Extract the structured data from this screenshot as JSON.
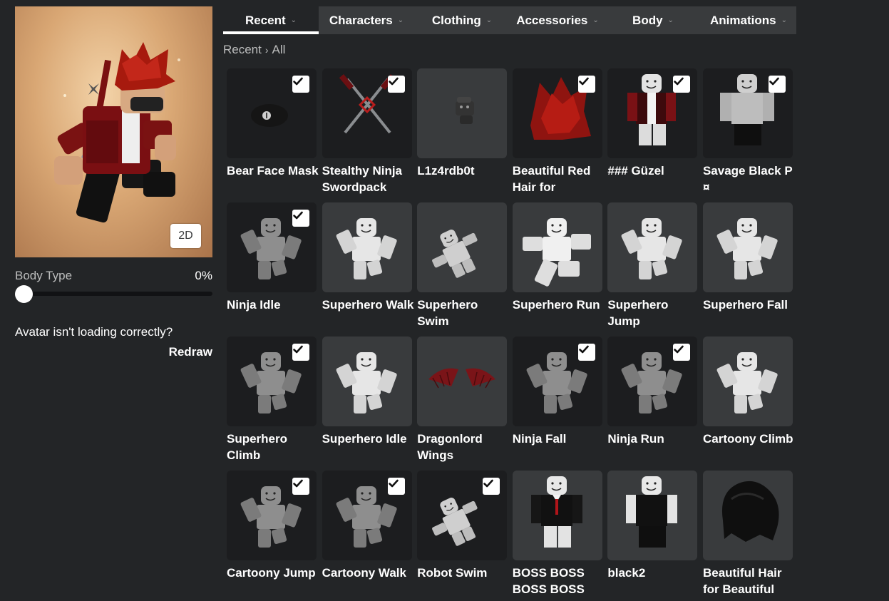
{
  "preview": {
    "toggle_label": "2D"
  },
  "body_type": {
    "label": "Body Type",
    "value": "0%",
    "level_percent": 0
  },
  "loading": {
    "message": "Avatar isn't loading correctly?",
    "redraw_label": "Redraw"
  },
  "tabs": [
    {
      "label": "Recent",
      "active": true
    },
    {
      "label": "Characters",
      "active": false
    },
    {
      "label": "Clothing",
      "active": false
    },
    {
      "label": "Accessories",
      "active": false
    },
    {
      "label": "Body",
      "active": false
    },
    {
      "label": "Animations",
      "active": false
    }
  ],
  "breadcrumb": {
    "parent": "Recent",
    "current": "All"
  },
  "items": [
    {
      "name": "Bear Face Mask",
      "selected": true,
      "bg": "dark",
      "thumb": "mask"
    },
    {
      "name": "Stealthy Ninja Swordpack",
      "selected": true,
      "bg": "dark",
      "thumb": "swords"
    },
    {
      "name": "L1z4rdb0t",
      "selected": false,
      "bg": "light",
      "thumb": "bot"
    },
    {
      "name": "Beautiful Red Hair for",
      "selected": true,
      "bg": "dark",
      "thumb": "redhair"
    },
    {
      "name": "### Güzel",
      "selected": true,
      "bg": "dark",
      "thumb": "redshirt"
    },
    {
      "name": "Savage Black P ¤",
      "selected": true,
      "bg": "dark",
      "thumb": "blackpants"
    },
    {
      "name": "Ninja Idle",
      "selected": true,
      "bg": "dark",
      "thumb": "pose-grey"
    },
    {
      "name": "Superhero Walk",
      "selected": false,
      "bg": "light",
      "thumb": "pose-white"
    },
    {
      "name": "Superhero Swim",
      "selected": false,
      "bg": "light",
      "thumb": "pose-swim"
    },
    {
      "name": "Superhero Run",
      "selected": false,
      "bg": "light",
      "thumb": "pose-run"
    },
    {
      "name": "Superhero Jump",
      "selected": false,
      "bg": "light",
      "thumb": "pose-white"
    },
    {
      "name": "Superhero Fall",
      "selected": false,
      "bg": "light",
      "thumb": "pose-white"
    },
    {
      "name": "Superhero Climb",
      "selected": true,
      "bg": "dark",
      "thumb": "pose-grey"
    },
    {
      "name": "Superhero Idle",
      "selected": false,
      "bg": "light",
      "thumb": "pose-white"
    },
    {
      "name": "Dragonlord Wings",
      "selected": false,
      "bg": "light",
      "thumb": "wings"
    },
    {
      "name": "Ninja Fall",
      "selected": true,
      "bg": "dark",
      "thumb": "pose-grey"
    },
    {
      "name": "Ninja Run",
      "selected": true,
      "bg": "dark",
      "thumb": "pose-grey"
    },
    {
      "name": "Cartoony Climb",
      "selected": false,
      "bg": "light",
      "thumb": "pose-white"
    },
    {
      "name": "Cartoony Jump",
      "selected": true,
      "bg": "dark",
      "thumb": "pose-grey"
    },
    {
      "name": "Cartoony Walk",
      "selected": true,
      "bg": "dark",
      "thumb": "pose-grey"
    },
    {
      "name": "Robot Swim",
      "selected": true,
      "bg": "dark",
      "thumb": "pose-swim"
    },
    {
      "name": "BOSS BOSS BOSS BOSS",
      "selected": false,
      "bg": "light",
      "thumb": "suit"
    },
    {
      "name": "black2",
      "selected": false,
      "bg": "light",
      "thumb": "black-outfit"
    },
    {
      "name": "Beautiful Hair for Beautiful",
      "selected": false,
      "bg": "light",
      "thumb": "blackhair"
    }
  ],
  "colors": {
    "page_bg": "#232527",
    "tab_bg": "#393b3d",
    "card_dark": "#1c1d1f",
    "card_light": "#393b3d",
    "accent": "#ffffff"
  }
}
